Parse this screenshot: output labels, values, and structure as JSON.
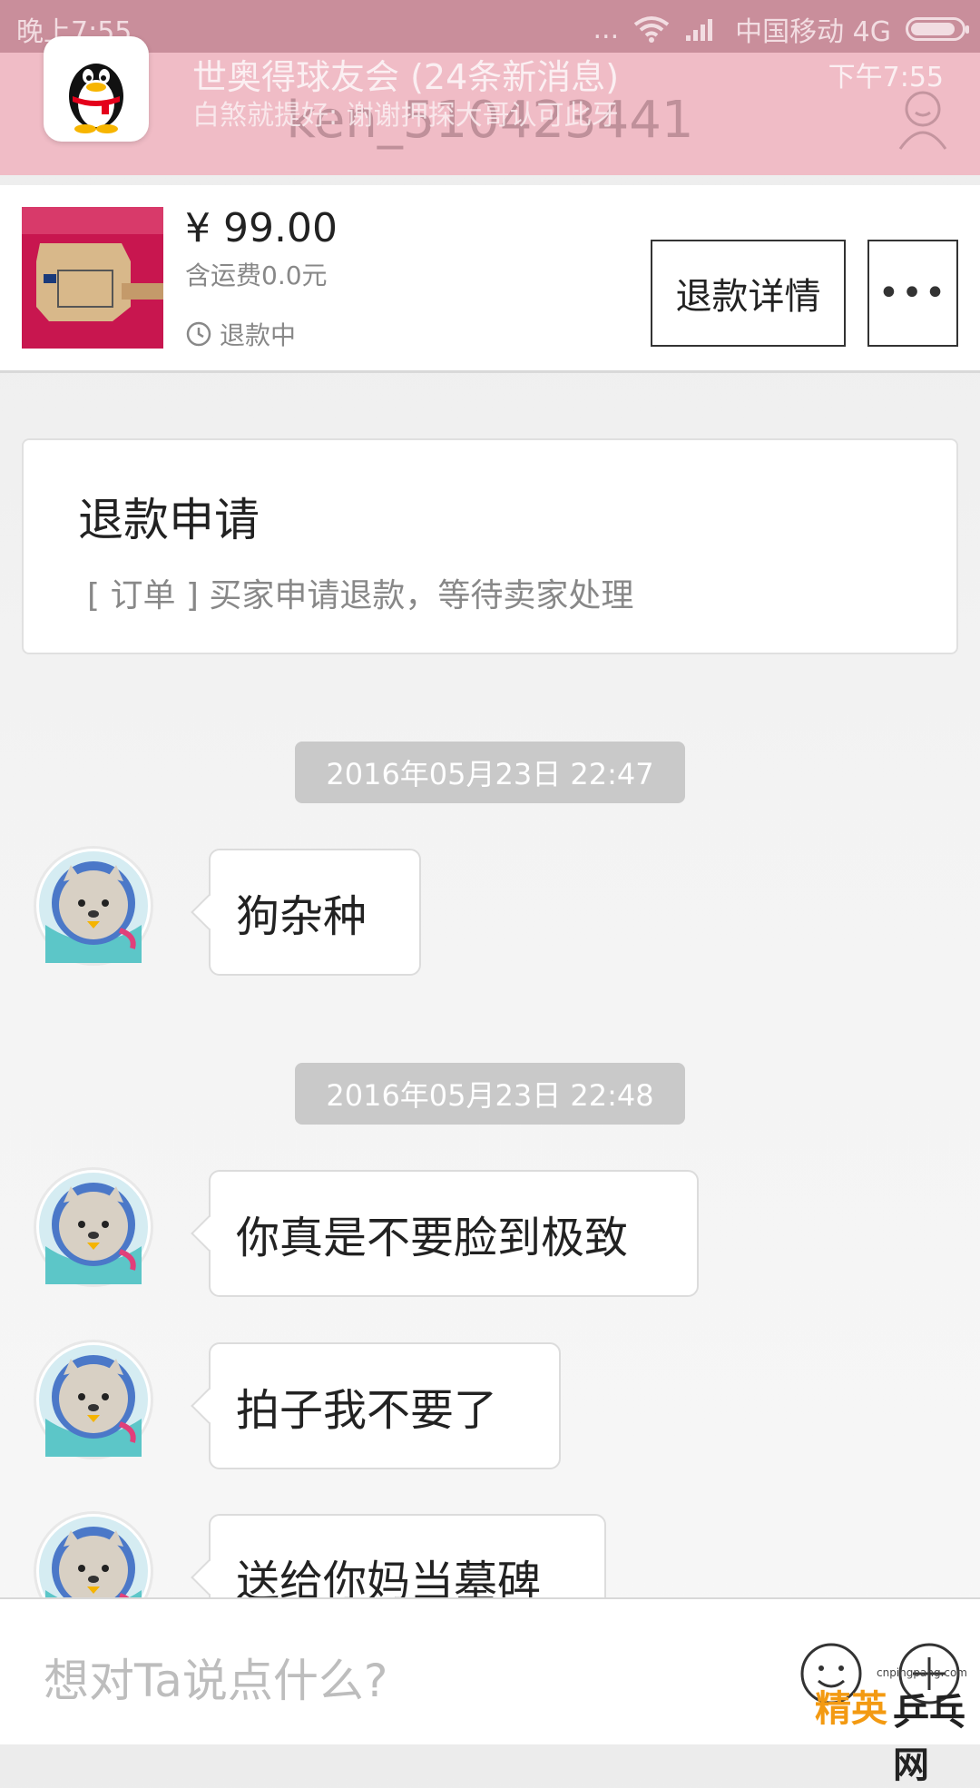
{
  "status_bar": {
    "time": "晚上7:55",
    "dots": "...",
    "carrier": "中国移动 4G"
  },
  "notification": {
    "title": "世奥得球友会 (24条新消息)",
    "text": "白煞就提好: 谢谢押探大哥认可此牙",
    "time": "下午7:55",
    "underlying_header": "ken_510423441"
  },
  "product": {
    "price": "¥ 99.00",
    "shipping": "含运费0.0元",
    "status": "退款中",
    "detail_button": "退款详情",
    "more_button": "•••"
  },
  "refund_card": {
    "title": "退款申请",
    "description": "[ 订单 ] 买家申请退款，等待卖家处理"
  },
  "chat": {
    "timestamps": [
      "2016年05月23日 22:47",
      "2016年05月23日 22:48"
    ],
    "messages": [
      "狗杂种",
      "你真是不要脸到极致",
      "拍子我不要了",
      "送给你妈当墓碑"
    ]
  },
  "input": {
    "placeholder": "想对Ta说点什么?"
  },
  "watermark": {
    "url": "cnpingpang.com",
    "brand_a": "精英",
    "brand_b": "乒乓网"
  },
  "colors": {
    "status_bar": "#c98e9b",
    "notification": "#f0bcc6",
    "timestamp_chip": "#c9c9c9"
  }
}
